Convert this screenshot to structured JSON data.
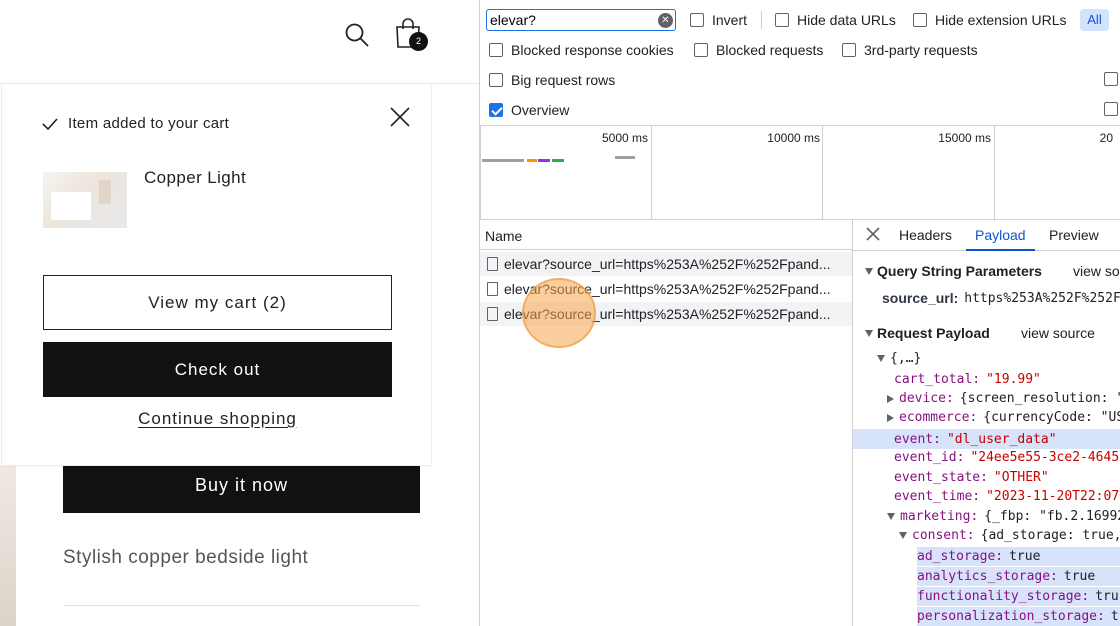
{
  "store": {
    "cart_count": "2",
    "popup": {
      "added_message": "Item added to your cart",
      "item_title": "Copper Light",
      "view_cart_label": "View my cart (2)",
      "checkout_label": "Check out",
      "continue_label": "Continue shopping"
    },
    "buy_now_label": "Buy it now",
    "product_description": "Stylish copper bedside light"
  },
  "devtools": {
    "filter": {
      "value": "elevar?"
    },
    "checkboxes": [
      {
        "label": "Invert",
        "checked": false
      },
      {
        "label": "Hide data URLs",
        "checked": false
      },
      {
        "label": "Hide extension URLs",
        "checked": false
      },
      {
        "label": "Blocked response cookies",
        "checked": false
      },
      {
        "label": "Blocked requests",
        "checked": false
      },
      {
        "label": "3rd-party requests",
        "checked": false
      },
      {
        "label": "Big request rows",
        "checked": false
      },
      {
        "label": "Overview",
        "checked": true
      }
    ],
    "all_button": "All",
    "timeline_ticks": [
      "5000 ms",
      "10000 ms",
      "15000 ms",
      "20"
    ],
    "name_header": "Name",
    "requests": [
      "elevar?source_url=https%253A%252F%252Fpand...",
      "elevar?source_url=https%253A%252F%252Fpand...",
      "elevar?source_url=https%253A%252F%252Fpand..."
    ],
    "tabs": [
      "Headers",
      "Payload",
      "Preview"
    ],
    "active_tab": "Payload",
    "query_section": {
      "title": "Query String Parameters",
      "view_source": "view so",
      "param_key": "source_url:",
      "param_value": "https%253A%252F%252Fp"
    },
    "payload_section": {
      "title": "Request Payload",
      "view_source": "view source",
      "root": "{,…}",
      "lines": [
        {
          "key": "cart_total:",
          "value": "\"19.99\""
        },
        {
          "key": "device:",
          "value": "{screen_resolution: \""
        },
        {
          "key": "ecommerce:",
          "value": "{currencyCode: \"US"
        },
        {
          "key": "event:",
          "value": "\"dl_user_data\""
        },
        {
          "key": "event_id:",
          "value": "\"24ee5e55-3ce2-4645-"
        },
        {
          "key": "event_state:",
          "value": "\"OTHER\""
        },
        {
          "key": "event_time:",
          "value": "\"2023-11-20T22:07"
        },
        {
          "key": "marketing:",
          "value": "{_fbp: \"fb.2.16992"
        },
        {
          "key": "consent:",
          "value": "{ad_storage: true,"
        },
        {
          "key": "ad_storage:",
          "value": "true"
        },
        {
          "key": "analytics_storage:",
          "value": "true"
        },
        {
          "key": "functionality_storage:",
          "value": "tru"
        },
        {
          "key": "personalization_storage:",
          "value": "t"
        }
      ]
    }
  }
}
